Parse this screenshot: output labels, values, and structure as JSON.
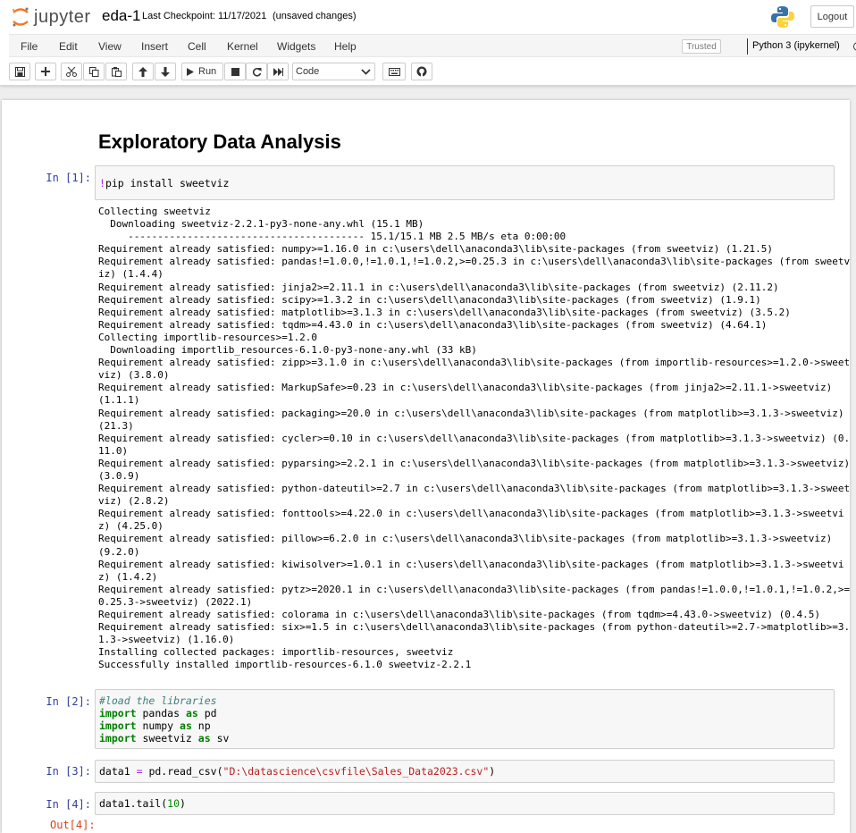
{
  "header": {
    "logo_text": "jupyter",
    "notebook_name": "eda-1",
    "checkpoint_label": "Last Checkpoint:",
    "checkpoint_date": "11/17/2021",
    "autosave_status": "(unsaved changes)",
    "logout_label": "Logout"
  },
  "menubar": {
    "items": [
      "File",
      "Edit",
      "View",
      "Insert",
      "Cell",
      "Kernel",
      "Widgets",
      "Help"
    ],
    "trusted_label": "Trusted",
    "kernel_name": "Python 3 (ipykernel)"
  },
  "toolbar": {
    "run_label": "Run",
    "cell_type": "Code"
  },
  "notebook": {
    "heading": "Exploratory Data Analysis",
    "cells": [
      {
        "prompt": "In [1]:",
        "code": "!pip install sweetviz",
        "output": [
          "Collecting sweetviz",
          "  Downloading sweetviz-2.2.1-py3-none-any.whl (15.1 MB)",
          "     ---------------------------------------- 15.1/15.1 MB 2.5 MB/s eta 0:00:00",
          "Requirement already satisfied: numpy>=1.16.0 in c:\\users\\dell\\anaconda3\\lib\\site-packages (from sweetviz) (1.21.5)",
          "Requirement already satisfied: pandas!=1.0.0,!=1.0.1,!=1.0.2,>=0.25.3 in c:\\users\\dell\\anaconda3\\lib\\site-packages (from sweetv",
          "iz) (1.4.4)",
          "Requirement already satisfied: jinja2>=2.11.1 in c:\\users\\dell\\anaconda3\\lib\\site-packages (from sweetviz) (2.11.2)",
          "Requirement already satisfied: scipy>=1.3.2 in c:\\users\\dell\\anaconda3\\lib\\site-packages (from sweetviz) (1.9.1)",
          "Requirement already satisfied: matplotlib>=3.1.3 in c:\\users\\dell\\anaconda3\\lib\\site-packages (from sweetviz) (3.5.2)",
          "Requirement already satisfied: tqdm>=4.43.0 in c:\\users\\dell\\anaconda3\\lib\\site-packages (from sweetviz) (4.64.1)",
          "Collecting importlib-resources>=1.2.0",
          "  Downloading importlib_resources-6.1.0-py3-none-any.whl (33 kB)",
          "Requirement already satisfied: zipp>=3.1.0 in c:\\users\\dell\\anaconda3\\lib\\site-packages (from importlib-resources>=1.2.0->sweet",
          "viz) (3.8.0)",
          "Requirement already satisfied: MarkupSafe>=0.23 in c:\\users\\dell\\anaconda3\\lib\\site-packages (from jinja2>=2.11.1->sweetviz)",
          "(1.1.1)",
          "Requirement already satisfied: packaging>=20.0 in c:\\users\\dell\\anaconda3\\lib\\site-packages (from matplotlib>=3.1.3->sweetviz)",
          "(21.3)",
          "Requirement already satisfied: cycler>=0.10 in c:\\users\\dell\\anaconda3\\lib\\site-packages (from matplotlib>=3.1.3->sweetviz) (0.",
          "11.0)",
          "Requirement already satisfied: pyparsing>=2.2.1 in c:\\users\\dell\\anaconda3\\lib\\site-packages (from matplotlib>=3.1.3->sweetviz)",
          "(3.0.9)",
          "Requirement already satisfied: python-dateutil>=2.7 in c:\\users\\dell\\anaconda3\\lib\\site-packages (from matplotlib>=3.1.3->sweet",
          "viz) (2.8.2)",
          "Requirement already satisfied: fonttools>=4.22.0 in c:\\users\\dell\\anaconda3\\lib\\site-packages (from matplotlib>=3.1.3->sweetvi",
          "z) (4.25.0)",
          "Requirement already satisfied: pillow>=6.2.0 in c:\\users\\dell\\anaconda3\\lib\\site-packages (from matplotlib>=3.1.3->sweetviz)",
          "(9.2.0)",
          "Requirement already satisfied: kiwisolver>=1.0.1 in c:\\users\\dell\\anaconda3\\lib\\site-packages (from matplotlib>=3.1.3->sweetvi",
          "z) (1.4.2)",
          "Requirement already satisfied: pytz>=2020.1 in c:\\users\\dell\\anaconda3\\lib\\site-packages (from pandas!=1.0.0,!=1.0.1,!=1.0.2,>=",
          "0.25.3->sweetviz) (2022.1)",
          "Requirement already satisfied: colorama in c:\\users\\dell\\anaconda3\\lib\\site-packages (from tqdm>=4.43.0->sweetviz) (0.4.5)",
          "Requirement already satisfied: six>=1.5 in c:\\users\\dell\\anaconda3\\lib\\site-packages (from python-dateutil>=2.7->matplotlib>=3.",
          "1.3->sweetviz) (1.16.0)",
          "Installing collected packages: importlib-resources, sweetviz",
          "Successfully installed importlib-resources-6.1.0 sweetviz-2.2.1"
        ]
      },
      {
        "prompt": "In [2]:",
        "code_lines": [
          "#load the libraries",
          "import pandas as pd",
          "import numpy as np",
          "import sweetviz as sv"
        ]
      },
      {
        "prompt": "In [3]:",
        "code_var": "data1",
        "code_eq": "=",
        "code_call": "pd.read_csv(",
        "code_str": "\"D:\\datascience\\csvfile\\Sales_Data2023.csv\"",
        "code_close": ")"
      },
      {
        "prompt": "In [4]:",
        "code_call": "data1.tail(",
        "code_num": "10",
        "code_close": ")"
      }
    ],
    "out_prompt_partial": "Out[4]:"
  },
  "colors": {
    "prompt_in": "#303f9f",
    "prompt_out": "#d84315",
    "keyword": "#008000",
    "comment": "#408080",
    "string": "#ba2121",
    "bang_operator": "#aa22ff"
  }
}
